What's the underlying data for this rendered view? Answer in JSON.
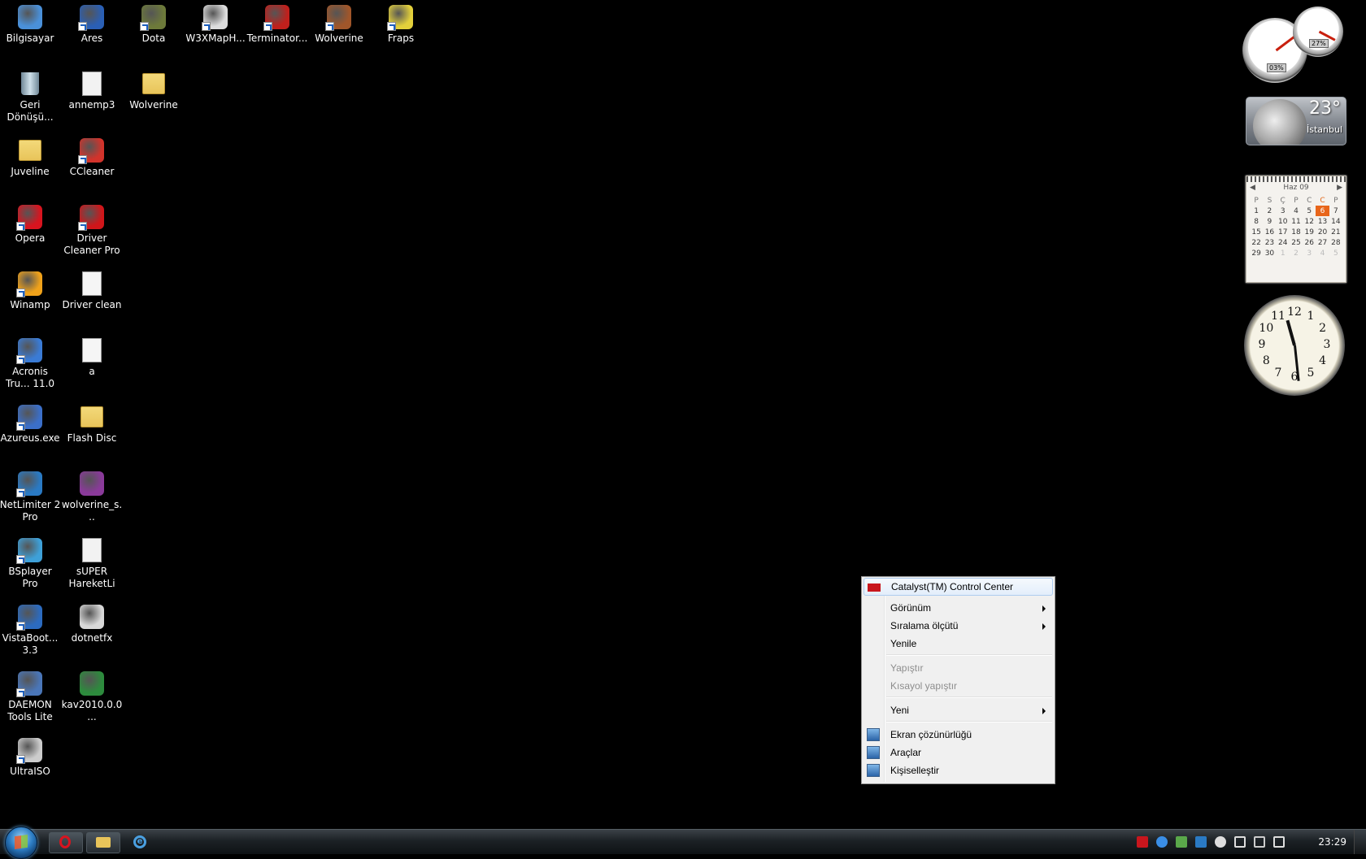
{
  "desktop_icons": [
    {
      "label": "Bilgisayar",
      "icon": "computer-icon",
      "color": "#4a90d9",
      "shortcut": false
    },
    {
      "label": "Ares",
      "icon": "ares-icon",
      "color": "#2a5fb5",
      "shortcut": true
    },
    {
      "label": "Dota",
      "icon": "dota-icon",
      "color": "#6d7a3a",
      "shortcut": true
    },
    {
      "label": "W3XMapH...",
      "icon": "w3xmaphack-icon",
      "color": "#dddddd",
      "shortcut": true
    },
    {
      "label": "Terminator...",
      "icon": "terminator-icon",
      "color": "#c0201c",
      "shortcut": true
    },
    {
      "label": "Wolverine",
      "icon": "wolverine-game-icon",
      "color": "#a0562a",
      "shortcut": true
    },
    {
      "label": "Fraps",
      "icon": "fraps-icon",
      "color": "#e3d03b",
      "shortcut": true
    },
    {
      "label": "Geri Dönüşü...",
      "icon": "recycle-bin-icon",
      "color": "#9bb7c9",
      "shortcut": false
    },
    {
      "label": "annemp3",
      "icon": "audio-file-icon",
      "color": "#f2f2f2",
      "shortcut": false
    },
    {
      "label": "Wolverine",
      "icon": "folder-icon",
      "color": "#e8c45a",
      "shortcut": false
    },
    {
      "label": "Juveline",
      "icon": "folder-icon",
      "color": "#e8c45a",
      "shortcut": false
    },
    {
      "label": "CCleaner",
      "icon": "ccleaner-icon",
      "color": "#d2332b",
      "shortcut": true
    },
    {
      "label": "Opera",
      "icon": "opera-icon",
      "color": "#d8141f",
      "shortcut": true
    },
    {
      "label": "Driver Cleaner Pro",
      "icon": "driver-cleaner-icon",
      "color": "#d0161a",
      "shortcut": true
    },
    {
      "label": "Winamp",
      "icon": "winamp-icon",
      "color": "#f0a21a",
      "shortcut": true
    },
    {
      "label": "Driver clean",
      "icon": "text-file-icon",
      "color": "#f5f5f5",
      "shortcut": false
    },
    {
      "label": "Acronis Tru... 11.0",
      "icon": "acronis-icon",
      "color": "#3a7bd5",
      "shortcut": true
    },
    {
      "label": "a",
      "icon": "text-file-icon",
      "color": "#f5f5f5",
      "shortcut": false
    },
    {
      "label": "Azureus.exe",
      "icon": "azureus-icon",
      "color": "#3b6fc9",
      "shortcut": true
    },
    {
      "label": "Flash Disc",
      "icon": "folder-icon",
      "color": "#e8c45a",
      "shortcut": false
    },
    {
      "label": "NetLimiter 2 Pro",
      "icon": "netlimiter-icon",
      "color": "#2a7ac4",
      "shortcut": true
    },
    {
      "label": "wolverine_s...",
      "icon": "winrar-archive-icon",
      "color": "#8a3a9a",
      "shortcut": false
    },
    {
      "label": "BSplayer Pro",
      "icon": "bsplayer-icon",
      "color": "#3ea0d8",
      "shortcut": true
    },
    {
      "label": "sUPER HareketLi",
      "icon": "audio-file-icon",
      "color": "#f2f2f2",
      "shortcut": false
    },
    {
      "label": "VistaBoot... 3.3",
      "icon": "vistaboot-icon",
      "color": "#2c6bbf",
      "shortcut": true
    },
    {
      "label": "dotnetfx",
      "icon": "installer-icon",
      "color": "#d8d8d8",
      "shortcut": false
    },
    {
      "label": "DAEMON Tools Lite",
      "icon": "daemon-tools-icon",
      "color": "#4a76b8",
      "shortcut": true
    },
    {
      "label": "kav2010.0.0...",
      "icon": "kaspersky-icon",
      "color": "#2d8b3d",
      "shortcut": false
    },
    {
      "label": "UltraISO",
      "icon": "ultraiso-icon",
      "color": "#cccccc",
      "shortcut": true
    }
  ],
  "gadgets": {
    "cpu_meter": {
      "cpu": "03%",
      "ram": "27%",
      "cpu_percent": 3,
      "ram_percent": 27
    },
    "weather": {
      "temperature": "23°",
      "city": "İstanbul"
    },
    "calendar": {
      "month": "Haz 09",
      "days_of_week": [
        "P",
        "S",
        "Ç",
        "P",
        "C",
        "C",
        "P"
      ],
      "weeks": [
        [
          "1",
          "2",
          "3",
          "4",
          "5",
          "6",
          "7"
        ],
        [
          "8",
          "9",
          "10",
          "11",
          "12",
          "13",
          "14"
        ],
        [
          "15",
          "16",
          "17",
          "18",
          "19",
          "20",
          "21"
        ],
        [
          "22",
          "23",
          "24",
          "25",
          "26",
          "27",
          "28"
        ],
        [
          "29",
          "30",
          "1",
          "2",
          "3",
          "4",
          "5"
        ]
      ],
      "today": "6",
      "accent": "#e8651a"
    },
    "clock": {
      "numbers": [
        "12",
        "1",
        "2",
        "3",
        "4",
        "5",
        "6",
        "7",
        "8",
        "9",
        "10",
        "11"
      ],
      "hour": 11,
      "minute": 29
    }
  },
  "context_menu": {
    "items": [
      {
        "label": "Catalyst(TM) Control Center",
        "icon": "ati-icon",
        "highlighted": true
      },
      {
        "label": "Görünüm",
        "submenu": true
      },
      {
        "label": "Sıralama ölçütü",
        "submenu": true
      },
      {
        "label": "Yenile"
      },
      {
        "label": "Yapıştır",
        "disabled": true
      },
      {
        "label": "Kısayol yapıştır",
        "disabled": true
      },
      {
        "label": "Yeni",
        "submenu": true
      },
      {
        "label": "Ekran çözünürlüğü",
        "icon": "display-icon"
      },
      {
        "label": "Araçlar",
        "icon": "gadgets-icon"
      },
      {
        "label": "Kişiselleştir",
        "icon": "personalize-icon"
      }
    ]
  },
  "taskbar": {
    "pinned": [
      {
        "name": "opera-taskbar-button",
        "icon": "opera-icon"
      },
      {
        "name": "explorer-taskbar-button",
        "icon": "folder-icon"
      },
      {
        "name": "ie-taskbar-button",
        "icon": "internet-explorer-icon"
      }
    ],
    "tray_icons": [
      "ati-icon",
      "skype-icon",
      "msn-icon",
      "netlimiter-icon",
      "bsplayer-icon",
      "flag-icon",
      "network-icon",
      "volume-icon"
    ],
    "time": "23:29"
  }
}
